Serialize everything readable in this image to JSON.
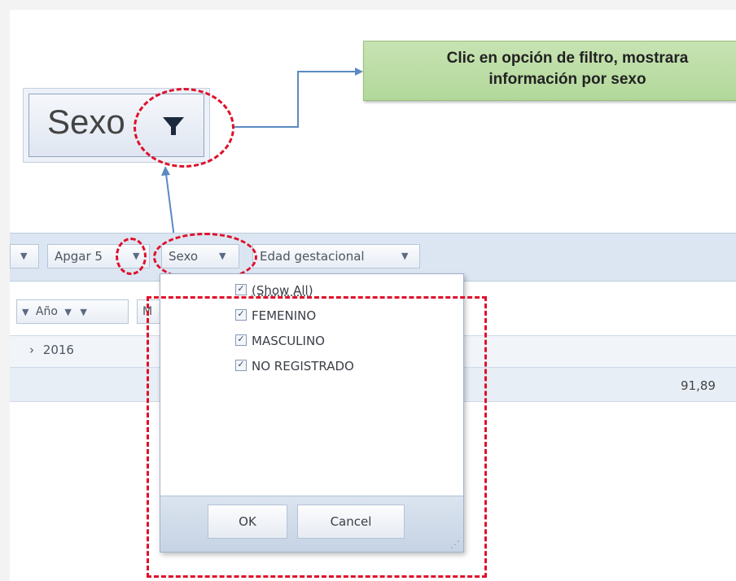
{
  "callout": {
    "field_label": "Sexo",
    "note": "Clic en opción de filtro, mostrara información por sexo"
  },
  "filter_bar": {
    "chips": [
      {
        "label": ""
      },
      {
        "label": "Apgar 5"
      },
      {
        "label": "Sexo"
      },
      {
        "label": "Edad gestacional"
      }
    ]
  },
  "row_area": {
    "year_chip": "Año",
    "partial_chip": "M"
  },
  "table": {
    "year": "2016",
    "total_value": "91,89"
  },
  "popup": {
    "options": [
      {
        "label": "(Show All)",
        "checked": true
      },
      {
        "label": "FEMENINO",
        "checked": true
      },
      {
        "label": "MASCULINO",
        "checked": true
      },
      {
        "label": "NO REGISTRADO",
        "checked": true
      }
    ],
    "ok_label": "OK",
    "cancel_label": "Cancel"
  },
  "icons": {
    "filter": "funnel-icon",
    "dropdown": "triangle-down-icon",
    "expand": "chevron-right-icon",
    "collapse": "chevron-down-icon",
    "check": "check-icon",
    "resize": "resize-grip-icon"
  },
  "colors": {
    "highlight": "#e0102a",
    "note_bg": "#b2d89a",
    "filter_bar_bg": "#dce6f2",
    "arrow": "#5b8ac0"
  }
}
